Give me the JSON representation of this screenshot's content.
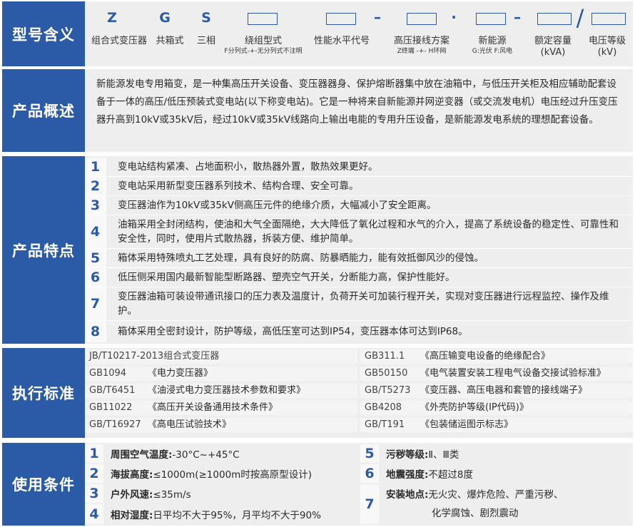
{
  "model": {
    "label": "型号含义",
    "letters": [
      "Z",
      "G",
      "S"
    ],
    "separators": [
      "–",
      "·",
      "–",
      "/"
    ],
    "columns": [
      {
        "title": "组合式变压器",
        "sub": ""
      },
      {
        "title": "共箱式",
        "sub": ""
      },
      {
        "title": "三相",
        "sub": ""
      },
      {
        "title": "绕组型式",
        "sub": "F分列式-+-无分列式不注明"
      },
      {
        "title": "性能水平代号",
        "sub": ""
      },
      {
        "title": "高压接线方案",
        "sub": "Z终端 -+- H环网"
      },
      {
        "title": "新能源",
        "sub": "G:光伏  F:风电"
      },
      {
        "title": "额定容量",
        "sub": "(kVA)"
      },
      {
        "title": "电压等级",
        "sub": "(kV)"
      }
    ]
  },
  "overview": {
    "label": "产品概述",
    "text": "新能源发电专用箱变，是一种集高压开关设备、变压器器身、保护熔断器集中放在油箱中，与低压开关柜及相应辅助配套设备于一体的高压/低压预装式变电站(以下称变电站)。它是一种将来自新能源并网逆变器（或交流发电机）电压经过升压变压器升高到10kV或35kV后，经过10kV或35kV线路向上输出电能的专用升压设备，是新能源发电系统的理想配套设备。"
  },
  "features": {
    "label": "产品特点",
    "items": [
      {
        "num": "1",
        "text": "变电站结构紧凑、占地面积小，散热器外置，散热效果更好。"
      },
      {
        "num": "2",
        "text": "变电站采用新型变压器系列技术、结构合理、安全可靠。"
      },
      {
        "num": "3",
        "text": "变压器油作为10kV或35kV侧高压元件的绝缘介质，大幅减小了安全距离。"
      },
      {
        "num": "4",
        "text": "油箱采用全封闭结构，使油和大气全面隔绝，大大降低了氧化过程和水气的介入，提高了系统设备的稳定性、可靠性和安全性，同时，使用片式散热器，拆装方便、维护简单。"
      },
      {
        "num": "5",
        "text": "箱体采用特殊喷丸工艺处理，具有良好的防腐、防暴晒能力，能有效抵御风沙的侵蚀。"
      },
      {
        "num": "6",
        "text": "低压侧采用国内最新智能型断路器、塑壳空气开关，分断能力高，保护性能好。"
      },
      {
        "num": "7",
        "text": "变压器油箱可装设带通讯接口的压力表及温度计，负荷开关可加装行程开关，实现对变压器进行远程监控、操作及维护。"
      },
      {
        "num": "8",
        "text": "箱体采用全密封设计，防护等级，高低压室可达到IP54，变压器本体可达到IP68。"
      }
    ]
  },
  "standards": {
    "label": "执行标准",
    "left": [
      {
        "code": "JB/T10217-2013组合式变压器",
        "name": ""
      },
      {
        "code": "GB1094",
        "name": "《电力变压器》"
      },
      {
        "code": "GB/T6451",
        "name": "《油浸式电力变压器技术参数和要求》"
      },
      {
        "code": "GB11022",
        "name": "《高压开关设备通用技术条件》"
      },
      {
        "code": "GB/T16927",
        "name": "《高电压试验技术》"
      }
    ],
    "right": [
      {
        "code": "GB311.1",
        "name": "《高压输变电设备的绝缘配合》"
      },
      {
        "code": "GB50150",
        "name": "《电气装置安装工程电气设备交接试验标准》"
      },
      {
        "code": "GB/T5273",
        "name": "《变压器、高压电器和套管的接线端子》"
      },
      {
        "code": "GB4208",
        "name": "《外壳防护等级(IP代码)》"
      },
      {
        "code": "GB/T191",
        "name": "《包装储运图示标志》"
      }
    ]
  },
  "conditions": {
    "label": "使用条件",
    "left": [
      {
        "num": "1",
        "key": "周围空气温度:",
        "value": "-30°C~+45°C"
      },
      {
        "num": "2",
        "key": "海拔高度:",
        "value": "≤1000m(≥1000m时按高原型设计)"
      },
      {
        "num": "3",
        "key": "户外风速:",
        "value": "≤35m/s"
      },
      {
        "num": "4",
        "key": "相对湿度:",
        "value": "日平均不大于95%，月平均不大于90%"
      }
    ],
    "right": [
      {
        "num": "5",
        "key": "污秽等级:",
        "value": "Ⅱ、Ⅲ类"
      },
      {
        "num": "6",
        "key": "地震强度:",
        "value": "不超过8度"
      },
      {
        "num": "7",
        "key": "安装地点:",
        "value": "无火灾、爆炸危险、严重污秽、",
        "value2": "化学腐蚀、剧烈震动"
      }
    ]
  }
}
